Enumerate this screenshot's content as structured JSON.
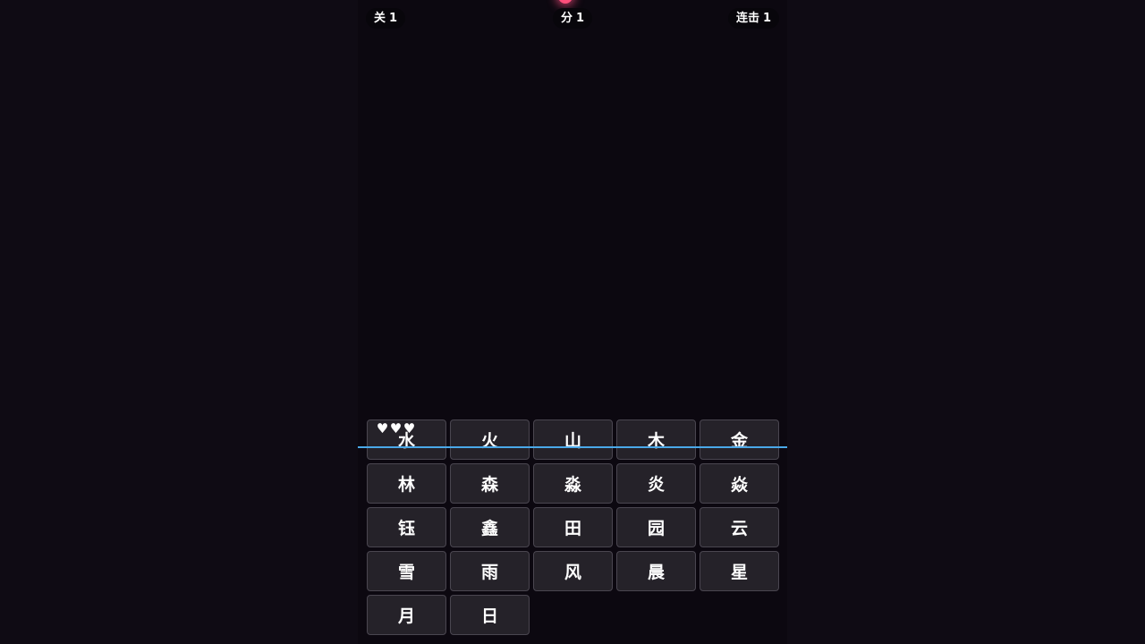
{
  "hud": {
    "level_label": "关",
    "level_value": "1",
    "score_label": "分",
    "score_value": "1",
    "combo_label": "连击",
    "combo_value": "1"
  },
  "lives": {
    "count": 3,
    "icon": "heart-icon",
    "glyph": "♥"
  },
  "tiles": [
    "水",
    "火",
    "山",
    "木",
    "金",
    "林",
    "森",
    "淼",
    "炎",
    "焱",
    "钰",
    "鑫",
    "田",
    "园",
    "云",
    "雪",
    "雨",
    "风",
    "晨",
    "星",
    "月",
    "日"
  ],
  "colors": {
    "background": "#0c0810",
    "tile": "#252229",
    "tile_border": "#4a4650",
    "line": "#4aa8e8",
    "orb": "#ff4f7b"
  }
}
